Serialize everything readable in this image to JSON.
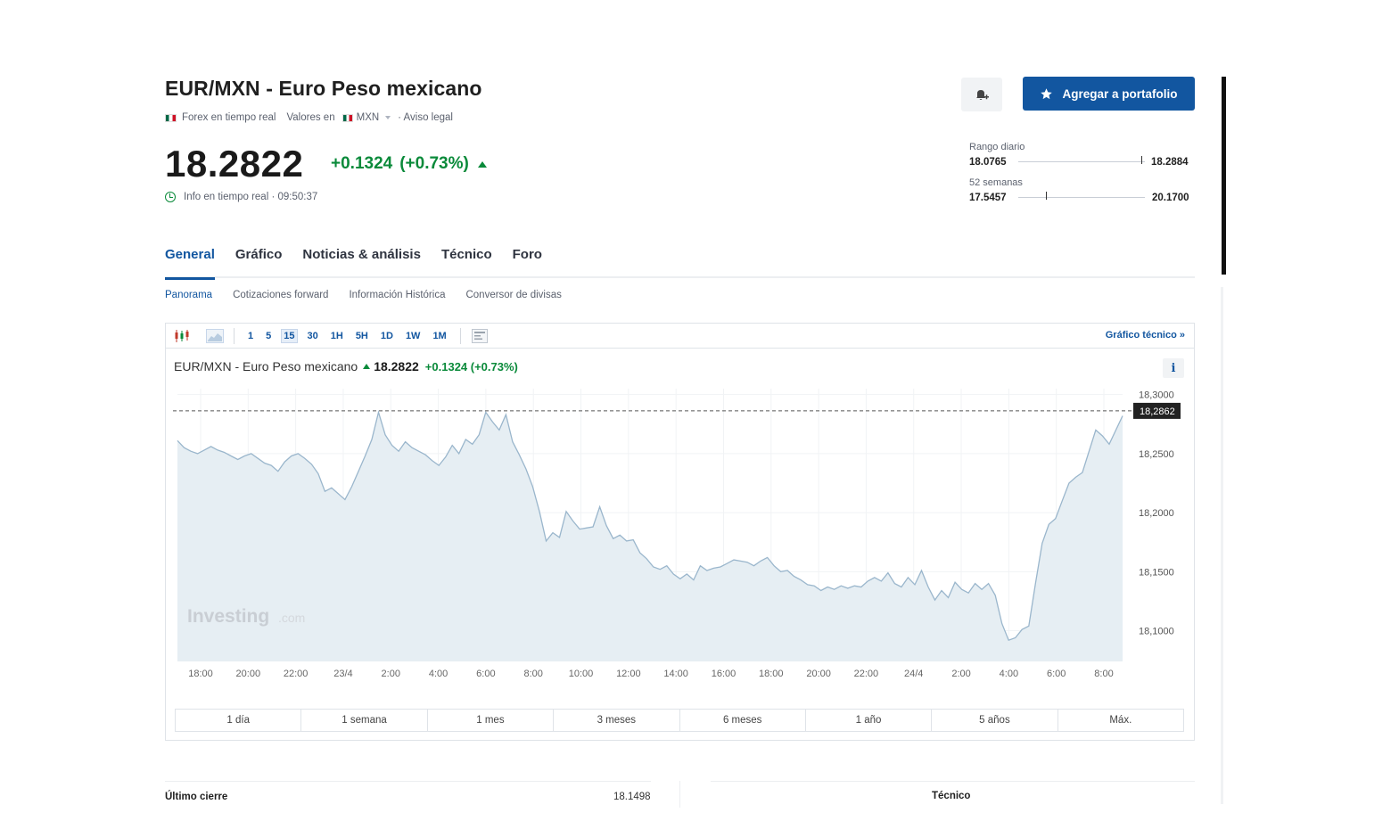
{
  "header": {
    "title": "EUR/MXN - Euro Peso mexicano",
    "meta": {
      "market": "Forex en tiempo real",
      "values_in_label": "Valores en",
      "currency": "MXN",
      "legal": "· Aviso legal"
    },
    "price": "18.2822",
    "change": "+0.1324",
    "change_pct": "(+0.73%)",
    "realtime_info": "Info en tiempo real · 09:50:37",
    "alert_icon": "bell-plus-icon",
    "portfolio_button": "Agregar a portafolio"
  },
  "ranges": {
    "daily": {
      "label": "Rango diario",
      "low": "18.0765",
      "high": "18.2884",
      "position": 0.97
    },
    "weeks52": {
      "label": "52 semanas",
      "low": "17.5457",
      "high": "20.1700",
      "position": 0.22
    }
  },
  "tabs": [
    {
      "label": "General",
      "active": true
    },
    {
      "label": "Gráfico",
      "active": false
    },
    {
      "label": "Noticias & análisis",
      "active": false
    },
    {
      "label": "Técnico",
      "active": false
    },
    {
      "label": "Foro",
      "active": false
    }
  ],
  "subtabs": [
    {
      "label": "Panorama",
      "active": true
    },
    {
      "label": "Cotizaciones forward",
      "active": false
    },
    {
      "label": "Información Histórica",
      "active": false
    },
    {
      "label": "Conversor de divisas",
      "active": false
    }
  ],
  "toolbar": {
    "intervals": [
      "1",
      "5",
      "15",
      "30",
      "1H",
      "5H",
      "1D",
      "1W",
      "1M"
    ],
    "active_interval": "15",
    "tech_chart_link": "Gráfico técnico »"
  },
  "legend": {
    "name": "EUR/MXN - Euro Peso mexicano",
    "price": "18.2822",
    "change": "+0.1324 (+0.73%)"
  },
  "range_buttons": [
    "1 día",
    "1 semana",
    "1 mes",
    "3 meses",
    "6 meses",
    "1 año",
    "5 años",
    "Máx."
  ],
  "bottom": {
    "last_close_label": "Último cierre",
    "last_close_value": "18.1498",
    "technical_label": "Técnico"
  },
  "chart_data": {
    "type": "area",
    "title": "EUR/MXN - Euro Peso mexicano",
    "watermark": "Investing.com",
    "x_tick_labels": [
      "18:00",
      "20:00",
      "22:00",
      "23/4",
      "2:00",
      "4:00",
      "6:00",
      "8:00",
      "10:00",
      "12:00",
      "14:00",
      "16:00",
      "18:00",
      "20:00",
      "22:00",
      "24/4",
      "2:00",
      "4:00",
      "6:00",
      "8:00"
    ],
    "y_tick_labels": [
      "18,3000",
      "18,2500",
      "18,2000",
      "18,1500",
      "18,1000"
    ],
    "ylim": [
      18.074,
      18.305
    ],
    "current_price_label": "18,2862",
    "current_price": 18.2862,
    "grid": true,
    "series": [
      {
        "values": [
          18.261,
          18.255,
          18.252,
          18.25,
          18.253,
          18.256,
          18.253,
          18.251,
          18.248,
          18.245,
          18.248,
          18.25,
          18.246,
          18.242,
          18.24,
          18.235,
          18.243,
          18.248,
          18.25,
          18.246,
          18.241,
          18.233,
          18.218,
          18.221,
          18.216,
          18.211,
          18.222,
          18.235,
          18.248,
          18.262,
          18.285,
          18.266,
          18.257,
          18.252,
          18.26,
          18.255,
          18.252,
          18.249,
          18.244,
          18.24,
          18.247,
          18.257,
          18.25,
          18.262,
          18.258,
          18.266,
          18.285,
          18.277,
          18.27,
          18.283,
          18.26,
          18.249,
          18.237,
          18.222,
          18.201,
          18.176,
          18.183,
          18.179,
          18.201,
          18.193,
          18.186,
          18.187,
          18.188,
          18.205,
          18.189,
          18.178,
          18.181,
          18.176,
          18.177,
          18.166,
          18.161,
          18.154,
          18.152,
          18.155,
          18.148,
          18.144,
          18.148,
          18.143,
          18.155,
          18.151,
          18.153,
          18.154,
          18.157,
          18.16,
          18.159,
          18.158,
          18.155,
          18.159,
          18.162,
          18.155,
          18.15,
          18.151,
          18.146,
          18.143,
          18.139,
          18.138,
          18.134,
          18.137,
          18.135,
          18.138,
          18.136,
          18.138,
          18.137,
          18.142,
          18.145,
          18.142,
          18.149,
          18.14,
          18.137,
          18.145,
          18.139,
          18.151,
          18.137,
          18.126,
          18.134,
          18.128,
          18.141,
          18.135,
          18.132,
          18.14,
          18.135,
          18.14,
          18.13,
          18.106,
          18.092,
          18.094,
          18.101,
          18.104,
          18.14,
          18.174,
          18.19,
          18.195,
          18.21,
          18.225,
          18.23,
          18.234,
          18.252,
          18.27,
          18.265,
          18.258,
          18.27,
          18.282
        ]
      }
    ],
    "colors": {
      "line": "#9ab6cc",
      "fill": "#e6eef3",
      "price_tag": "#222222",
      "up": "#0a8a3a",
      "accent": "#1256a0"
    }
  }
}
